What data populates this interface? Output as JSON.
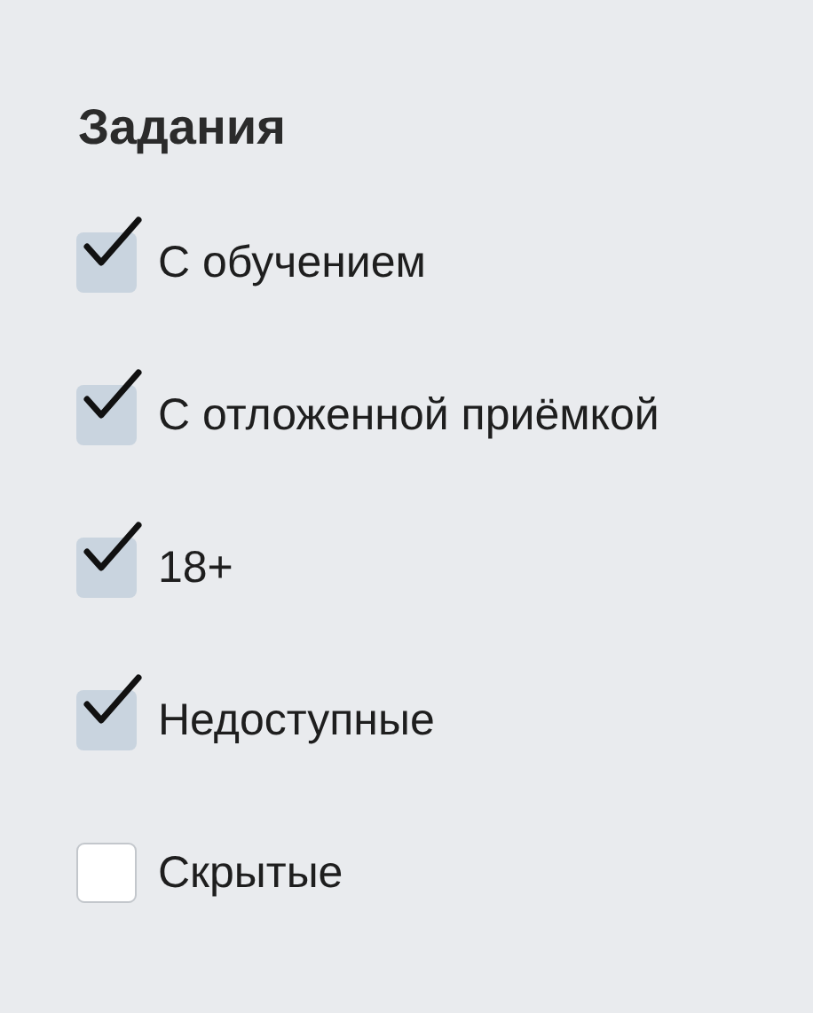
{
  "filter": {
    "title": "Задания",
    "options": [
      {
        "label": "С обучением",
        "checked": true
      },
      {
        "label": "С отложенной приёмкой",
        "checked": true
      },
      {
        "label": "18+",
        "checked": true
      },
      {
        "label": "Недоступные",
        "checked": true
      },
      {
        "label": "Скрытые",
        "checked": false
      }
    ]
  }
}
